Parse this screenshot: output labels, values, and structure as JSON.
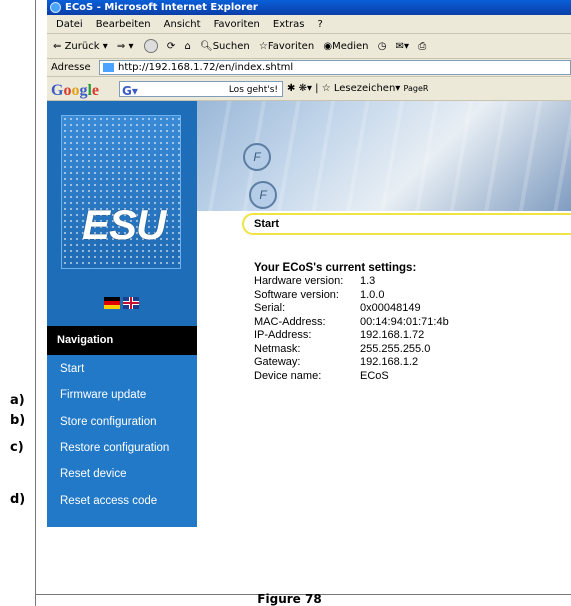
{
  "window": {
    "title": "ECoS - Microsoft Internet Explorer"
  },
  "menubar": [
    "Datei",
    "Bearbeiten",
    "Ansicht",
    "Favoriten",
    "Extras",
    "?"
  ],
  "toolbar": {
    "back": "Zurück",
    "search": "Suchen",
    "favorites": "Favoriten",
    "media": "Medien"
  },
  "addressbar": {
    "label": "Adresse",
    "url": "http://192.168.1.72/en/index.shtml"
  },
  "googlebar": {
    "logo": "Google",
    "search_btn": "Los geht's!",
    "bookmarks": "Lesezeichen",
    "page": "PageR"
  },
  "logo": {
    "brand": "ESU"
  },
  "sidebar": {
    "heading": "Navigation",
    "items": [
      {
        "label": "Start"
      },
      {
        "label": "Firmware update"
      },
      {
        "label": "Store configuration"
      },
      {
        "label": "Restore configuration"
      },
      {
        "label": "Reset device"
      },
      {
        "label": "Reset access code"
      }
    ]
  },
  "main": {
    "section_title": "Start",
    "settings_title": "Your ECoS's current settings:",
    "settings": [
      {
        "key": "Hardware version:",
        "value": "1.3"
      },
      {
        "key": "Software version:",
        "value": "1.0.0"
      },
      {
        "key": "Serial:",
        "value": "0x00048149"
      },
      {
        "key": "MAC-Address:",
        "value": "00:14:94:01:71:4b"
      },
      {
        "key": "IP-Address:",
        "value": "192.168.1.72"
      },
      {
        "key": "Netmask:",
        "value": "255.255.255.0"
      },
      {
        "key": "Gateway:",
        "value": "192.168.1.2"
      },
      {
        "key": "Device name:",
        "value": "ECoS"
      }
    ]
  },
  "annotations": [
    "a)",
    "b)",
    "c)",
    "d)"
  ],
  "caption": "Figure 78",
  "colors": {
    "sidebar": "#2179c8",
    "nav_head": "#000000",
    "section_border": "#f0e442",
    "titlebar": "#0a4fc4"
  }
}
